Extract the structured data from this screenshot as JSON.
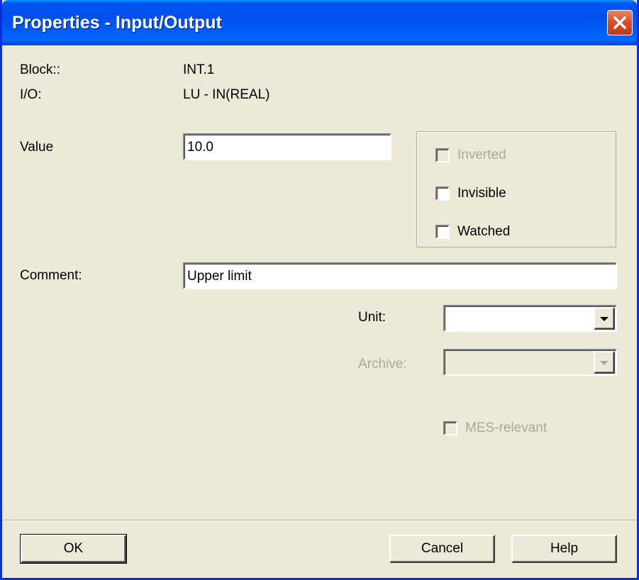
{
  "window": {
    "title": "Properties - Input/Output",
    "close_icon": "close-icon"
  },
  "info": {
    "block_label": "Block::",
    "block_value": "INT.1",
    "io_label": "I/O:",
    "io_value": "LU  -  IN(REAL)"
  },
  "value": {
    "label": "Value",
    "input_value": "10.0"
  },
  "options": {
    "inverted": {
      "label": "Inverted",
      "checked": false,
      "enabled": false
    },
    "invisible": {
      "label": "Invisible",
      "checked": false,
      "enabled": true
    },
    "watched": {
      "label": "Watched",
      "checked": false,
      "enabled": true
    }
  },
  "comment": {
    "label": "Comment:",
    "input_value": "Upper limit"
  },
  "unit": {
    "label": "Unit:",
    "selected": "",
    "enabled": true
  },
  "archive": {
    "label": "Archive:",
    "selected": "",
    "enabled": false
  },
  "mes": {
    "label": "MES-relevant",
    "checked": false,
    "enabled": false
  },
  "buttons": {
    "ok": "OK",
    "cancel": "Cancel",
    "help": "Help"
  },
  "colors": {
    "title_bar": "#0054E3",
    "dialog_bg": "#ECE9D8",
    "disabled_text": "#ACA899",
    "close_button": "#D9512C"
  }
}
